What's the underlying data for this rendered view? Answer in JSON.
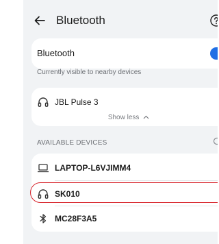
{
  "header": {
    "title": "Bluetooth"
  },
  "bluetooth": {
    "label": "Bluetooth",
    "enabled": true
  },
  "visibility_text": "Currently visible to nearby devices",
  "paired": {
    "devices": [
      {
        "name": "JBL Pulse 3",
        "icon": "headphones-icon"
      }
    ],
    "show_less_label": "Show less"
  },
  "available": {
    "heading": "AVAILABLE DEVICES",
    "devices": [
      {
        "name": "LAPTOP-L6VJIMM4",
        "icon": "laptop-icon"
      },
      {
        "name": "SK010",
        "icon": "headphones-icon",
        "highlighted": true
      },
      {
        "name": "MC28F3A5",
        "icon": "bluetooth-icon"
      }
    ]
  },
  "colors": {
    "accent": "#1f6fe5",
    "highlight": "#d8262e",
    "background": "#f1f3f5"
  }
}
